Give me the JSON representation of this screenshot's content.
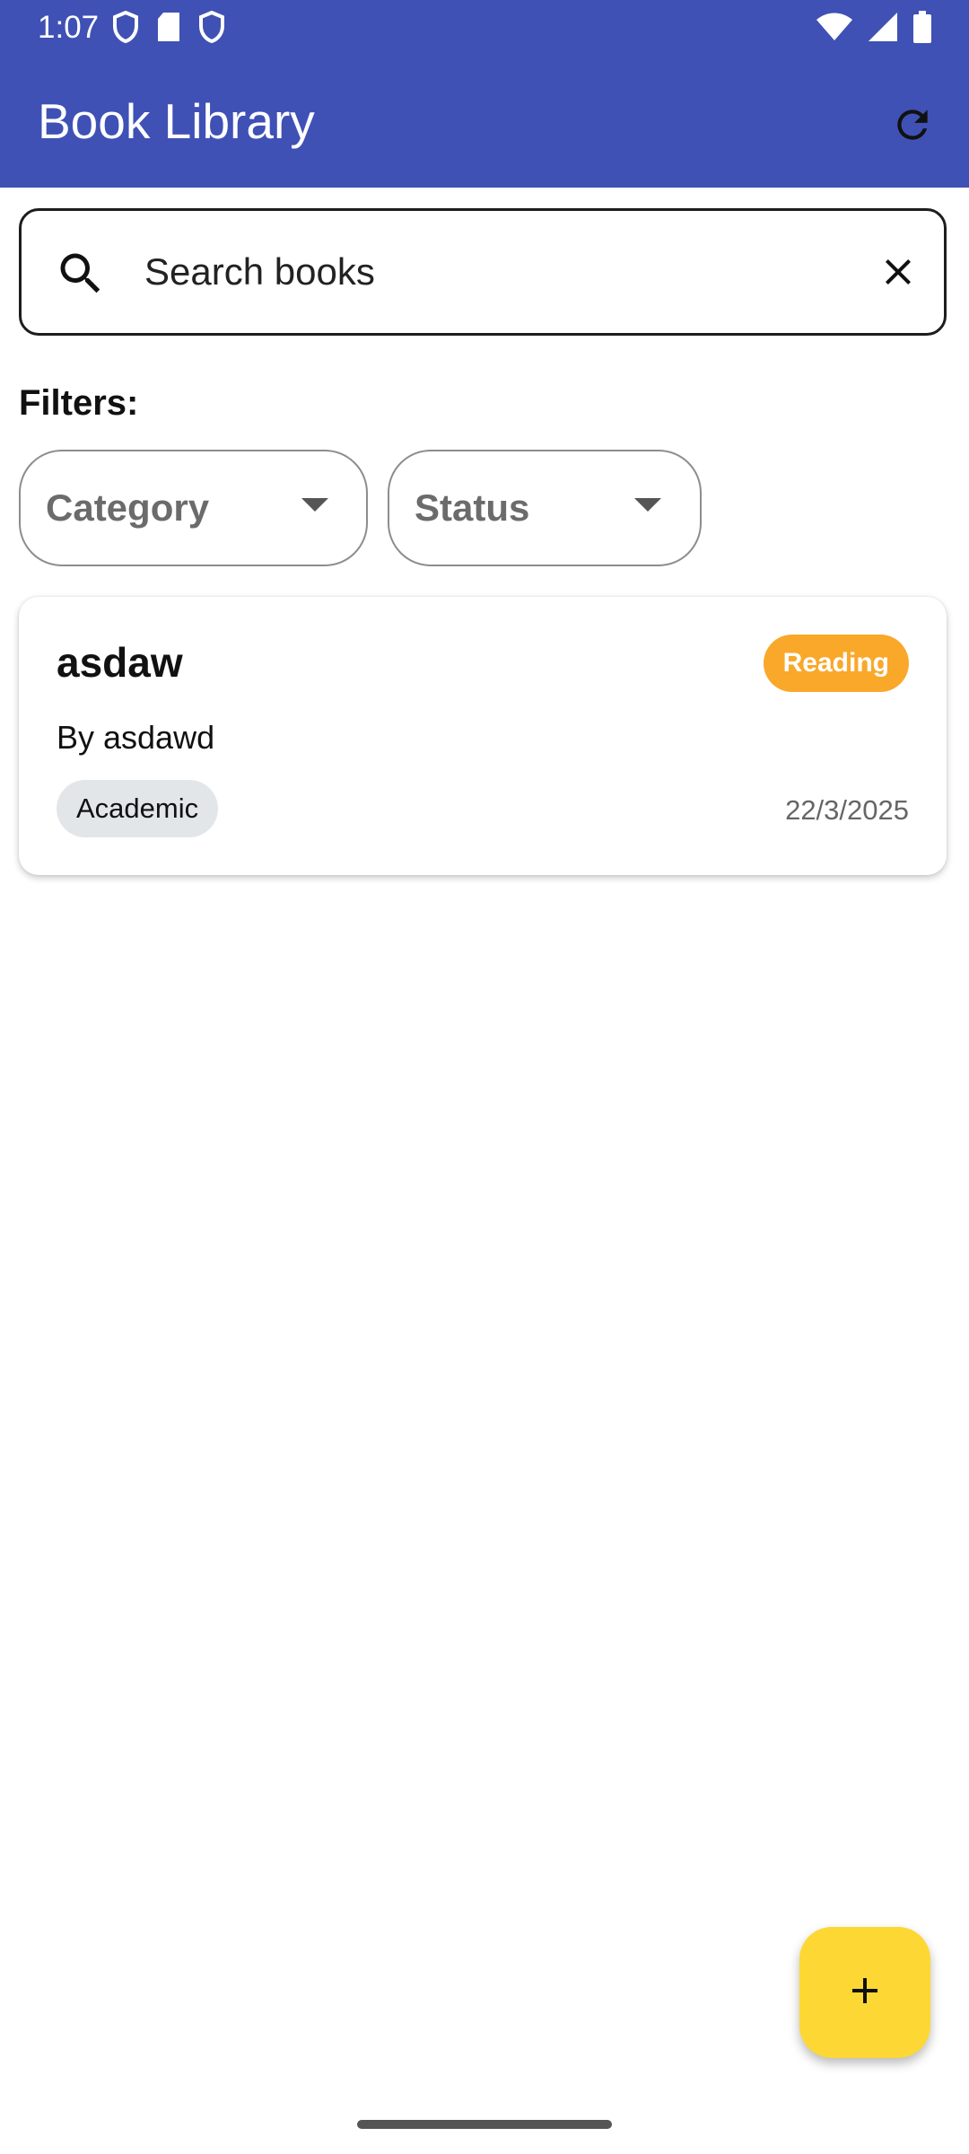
{
  "status_bar": {
    "time": "1:07",
    "left_icons": [
      "shield-icon",
      "sd-card-icon",
      "shield-icon"
    ],
    "right_icons": [
      "wifi-icon",
      "signal-icon",
      "battery-icon"
    ]
  },
  "app_bar": {
    "title": "Book Library",
    "refresh_icon": "refresh-icon",
    "color": "#3f51b5"
  },
  "search": {
    "placeholder": "Search books",
    "value": ""
  },
  "filters": {
    "label": "Filters:",
    "category": {
      "label": "Category"
    },
    "status": {
      "label": "Status"
    }
  },
  "books": [
    {
      "title": "asdaw",
      "author": "By asdawd",
      "status": "Reading",
      "status_color": "#f9a82a",
      "category": "Academic",
      "date": "22/3/2025"
    }
  ],
  "fab": {
    "icon": "plus-icon",
    "color": "#fdd835"
  }
}
